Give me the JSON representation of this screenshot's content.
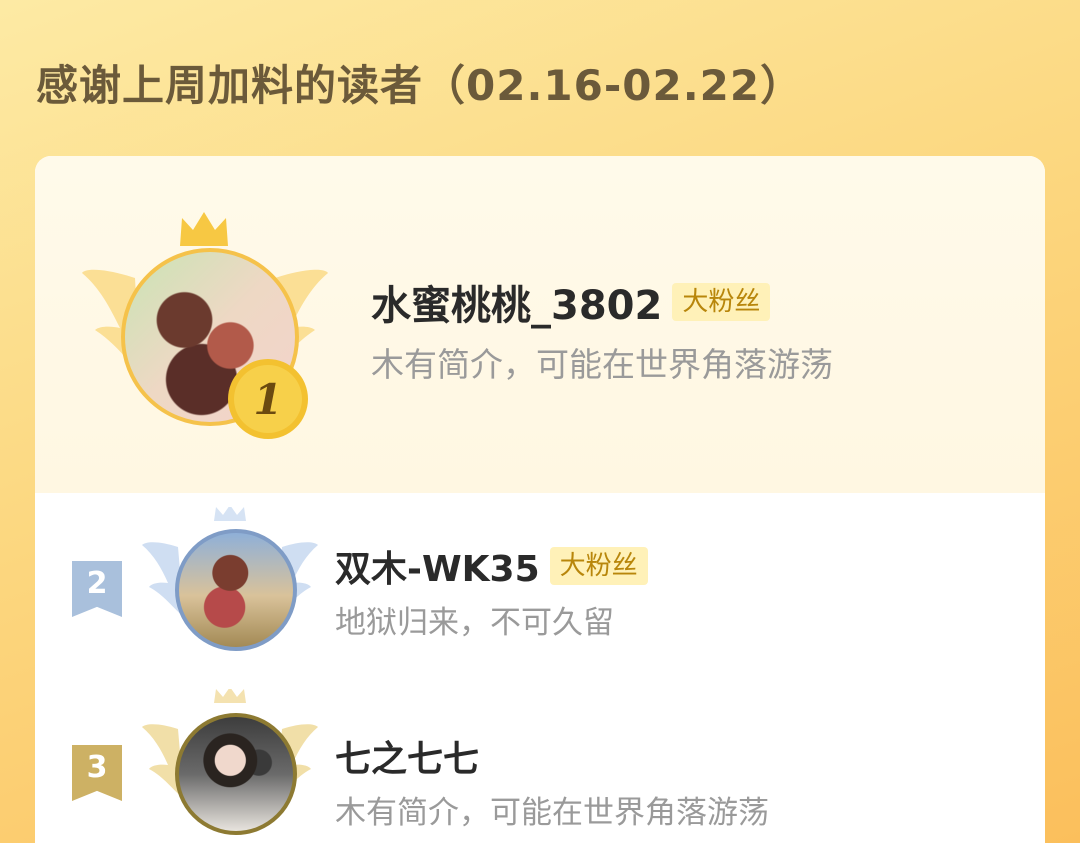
{
  "header": {
    "title": "感谢上周加料的读者（02.16-02.22）"
  },
  "readers": [
    {
      "rank": "1",
      "name": "水蜜桃桃_3802",
      "badge": "大粉丝",
      "bio": "木有简介，可能在世界角落游荡"
    },
    {
      "rank": "2",
      "name": "双木-WK35",
      "badge": "大粉丝",
      "bio": "地狱归来，不可久留"
    },
    {
      "rank": "3",
      "name": "七之七七",
      "bio": "木有简介，可能在世界角落游荡"
    }
  ],
  "icons": [
    "crown-icon",
    "wings-icon",
    "rank-medal-icon",
    "rank-flag-icon",
    "avatar"
  ],
  "colors": {
    "gold": "#e8b52a",
    "silver": "#9cb3d4",
    "bronze": "#c9a64a",
    "badge_bg": "#fff1b8",
    "badge_text": "#b8860b"
  }
}
